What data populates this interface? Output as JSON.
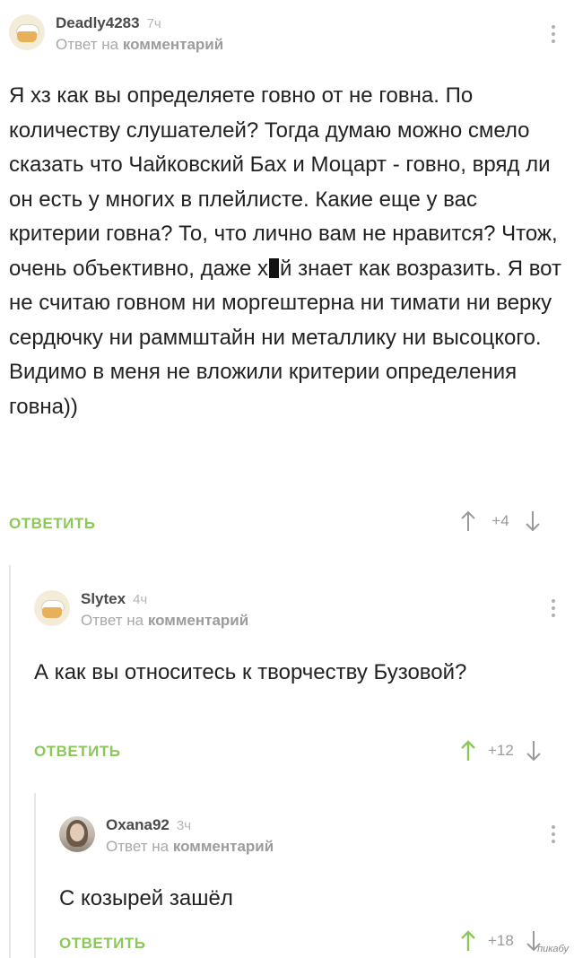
{
  "comments": [
    {
      "username": "Deadly4283",
      "time": "7ч",
      "reply_prefix": "Ответ на ",
      "reply_link": "комментарий",
      "body_part1": "Я хз как вы определяете говно от не говна. По количеству слушателей? Тогда думаю можно смело сказать что Чайковский Бах и Моцарт - говно, вряд ли он есть у многих в плейлисте. Какие еще у вас критерии говна? То, что лично вам не нравится? Чтож, очень объективно, даже х",
      "body_part2": "й знает как возразить. Я вот не считаю говном ни моргештерна ни тимати ни верку сердючку ни раммштайн ни металлику ни высоцкого. Видимо в меня не вложили критерии определения говна))",
      "reply_label": "ОТВЕТИТЬ",
      "score": "+4",
      "avatar_icon": "pie-avatar-icon"
    },
    {
      "username": "Slytex",
      "time": "4ч",
      "reply_prefix": "Ответ на ",
      "reply_link": "комментарий",
      "body": "А как вы относитесь к творчеству Бузовой?",
      "reply_label": "ОТВЕТИТЬ",
      "score": "+12",
      "avatar_icon": "pie-avatar-icon"
    },
    {
      "username": "Oxana92",
      "time": "3ч",
      "reply_prefix": "Ответ на ",
      "reply_link": "комментарий",
      "body": "С козырей зашёл",
      "reply_label": "ОТВЕТИТЬ",
      "score": "+18",
      "avatar_icon": "photo-avatar-icon"
    }
  ],
  "colors": {
    "accent_green": "#8ac858",
    "meta_gray": "#a8a8a8",
    "text": "#222222"
  },
  "watermark": "пикабу"
}
